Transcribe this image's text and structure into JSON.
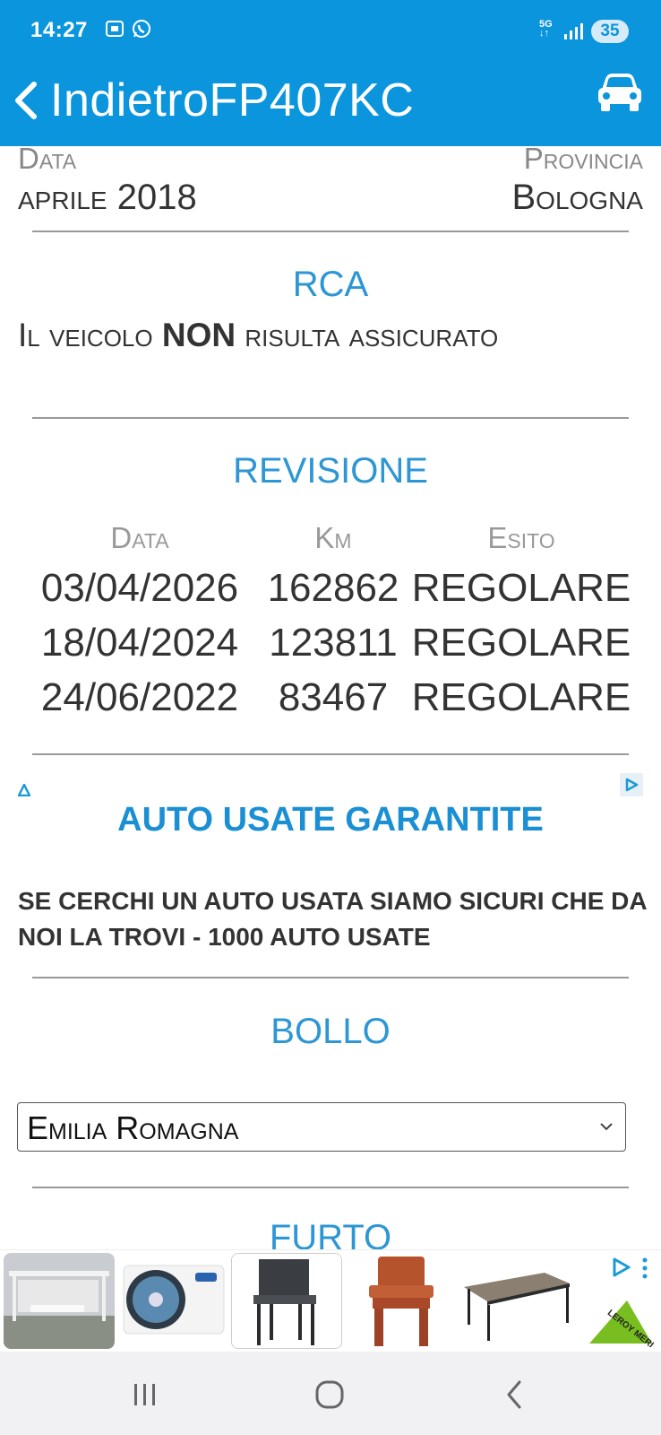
{
  "status_bar": {
    "time": "14:27",
    "network": "5G",
    "battery": "35"
  },
  "nav": {
    "back_label": "Indietro",
    "title": "FP407KC",
    "car_icon": "car-icon"
  },
  "info": {
    "date_label": "Data",
    "date_value": "aprile 2018",
    "province_label": "Provincia",
    "province_value": "Bologna"
  },
  "rca": {
    "title": "RCA",
    "text_before": "Il veicolo ",
    "text_bold": "NON",
    "text_after": " risulta assicurato"
  },
  "revisione": {
    "title": "REVISIONE",
    "headers": [
      "Data",
      "Km",
      "Esito"
    ],
    "rows": [
      [
        "03/04/2026",
        "162862",
        "REGOLARE"
      ],
      [
        "18/04/2024",
        "123811",
        "REGOLARE"
      ],
      [
        "24/06/2022",
        "83467",
        "REGOLARE"
      ]
    ]
  },
  "ad": {
    "title": "AUTO USATE GARANTITE",
    "body": "SE CERCHI UN AUTO USATA SIAMO SICURI CHE DA NOI LA TROVI - 1000 AUTO USATE"
  },
  "bollo": {
    "title": "BOLLO",
    "selected_region": "Emilia Romagna"
  },
  "furto": {
    "title": "FURTO"
  },
  "colors": {
    "header": "#0b95dc",
    "section_title": "#2d96d4",
    "ad_title": "#1a8fd4"
  }
}
